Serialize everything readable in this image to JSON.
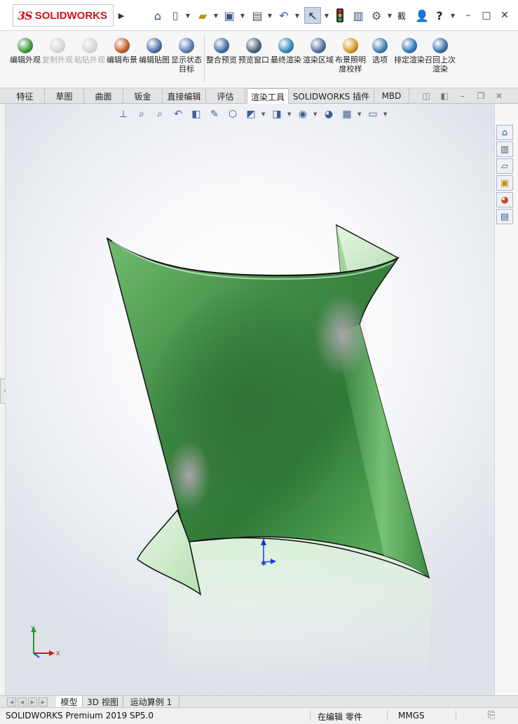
{
  "app": {
    "logo_ds": "3S",
    "logo_text": "SOLIDWORKS",
    "quick_access": {
      "home_icon": "home-icon",
      "new_icon": "new-document-icon",
      "open_icon": "open-folder-icon",
      "save_icon": "save-icon",
      "print_icon": "print-icon",
      "undo_icon": "undo-icon",
      "select_icon": "select-pointer-icon",
      "rebuild_icon": "traffic-light-icon",
      "file_props_icon": "file-properties-icon",
      "options_icon": "gear-icon",
      "search_label": "截",
      "user_icon": "user-icon",
      "help_label": "?"
    }
  },
  "ribbon": {
    "buttons": [
      {
        "label": "编辑外观",
        "enabled": true,
        "color": "#3a9a3a"
      },
      {
        "label": "复制外观",
        "enabled": false,
        "color": "#999999"
      },
      {
        "label": "粘贴外观",
        "enabled": false,
        "color": "#999999"
      },
      {
        "label": "编辑布景",
        "enabled": true,
        "color": "#c85a2a"
      },
      {
        "label": "编辑贴图",
        "enabled": true,
        "color": "#4a6ea8"
      },
      {
        "label": "显示状态目标",
        "enabled": true,
        "color": "#5a7ab0"
      },
      {
        "label": "整合预览",
        "enabled": true,
        "color": "#3f6aa6"
      },
      {
        "label": "预览窗口",
        "enabled": true,
        "color": "#4a5f7a"
      },
      {
        "label": "最终渲染",
        "enabled": true,
        "color": "#2f8ab8"
      },
      {
        "label": "渲染区域",
        "enabled": true,
        "color": "#4e6f9c"
      },
      {
        "label": "布景照明度校样",
        "enabled": true,
        "color": "#d49a1e"
      },
      {
        "label": "选项",
        "enabled": true,
        "color": "#3a7fb0"
      },
      {
        "label": "排定渲染",
        "enabled": true,
        "color": "#2e78b4"
      },
      {
        "label": "召回上次渲染",
        "enabled": true,
        "color": "#3a6fa6"
      }
    ]
  },
  "tabs": [
    {
      "label": "特征",
      "active": false
    },
    {
      "label": "草图",
      "active": false
    },
    {
      "label": "曲面",
      "active": false
    },
    {
      "label": "钣金",
      "active": false
    },
    {
      "label": "直接编辑",
      "active": false
    },
    {
      "label": "评估",
      "active": false
    },
    {
      "label": "渲染工具",
      "active": true
    },
    {
      "label": "SOLIDWORKS 插件",
      "active": false
    },
    {
      "label": "MBD",
      "active": false
    }
  ],
  "triad": {
    "y": "Y",
    "x": "X"
  },
  "bottom_tabs": [
    {
      "label": "模型",
      "active": true
    },
    {
      "label": "3D 视图",
      "active": false
    },
    {
      "label": "运动算例 1",
      "active": false
    }
  ],
  "status": {
    "product": "SOLIDWORKS Premium 2019 SP5.0",
    "mode": "在编辑 零件",
    "units": "MMGS"
  },
  "colors": {
    "accent": "#d0111b",
    "surface_green": "#4f9a4f"
  }
}
